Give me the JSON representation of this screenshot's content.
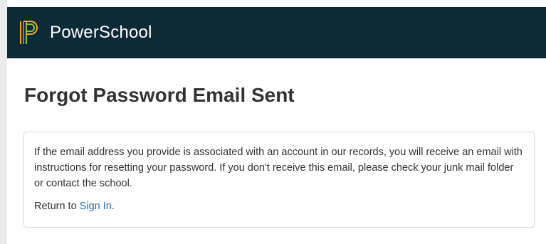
{
  "header": {
    "brand": "PowerSchool",
    "logo_icon": "powerschool-logo-icon",
    "background_color": "#0d2a38"
  },
  "page": {
    "title": "Forgot Password Email Sent"
  },
  "message": {
    "body": "If the email address you provide is associated with an account in our records, you will receive an email with instructions for resetting your password. If you don't receive this email, please check your junk mail folder or contact the school.",
    "return_prefix": "Return to ",
    "sign_in_label": "Sign In",
    "return_suffix": ".",
    "link_color": "#2a6db0"
  }
}
